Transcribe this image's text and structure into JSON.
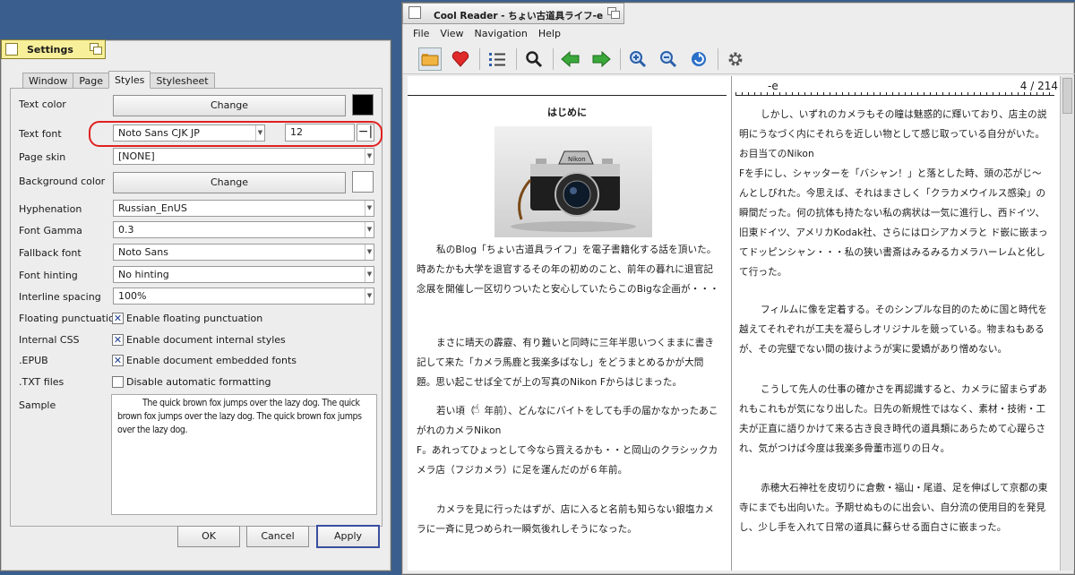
{
  "settings": {
    "title": "Settings",
    "tabs": [
      "Window",
      "Page",
      "Styles",
      "Stylesheet"
    ],
    "active_tab": "Styles",
    "text_color": {
      "label": "Text color",
      "button": "Change",
      "color": "#000000"
    },
    "text_font": {
      "label": "Text font",
      "value": "Noto Sans CJK JP",
      "size": "12"
    },
    "page_skin": {
      "label": "Page skin",
      "value": "[NONE]"
    },
    "background_color": {
      "label": "Background color",
      "button": "Change",
      "color": "#ffffff"
    },
    "hyphenation": {
      "label": "Hyphenation",
      "value": "Russian_EnUS"
    },
    "font_gamma": {
      "label": "Font Gamma",
      "value": "0.3"
    },
    "fallback_font": {
      "label": "Fallback font",
      "value": "Noto Sans"
    },
    "font_hinting": {
      "label": "Font hinting",
      "value": "No hinting"
    },
    "interline_spacing": {
      "label": "Interline spacing",
      "value": "100%"
    },
    "floating_punctuation": {
      "label": "Floating punctuation",
      "checkbox": "Enable floating punctuation",
      "checked": true
    },
    "internal_css": {
      "label": "Internal CSS",
      "checkbox": "Enable document internal styles",
      "checked": true
    },
    "epub": {
      "label": ".EPUB",
      "checkbox": "Enable document embedded fonts",
      "checked": true
    },
    "txt_files": {
      "label": ".TXT files",
      "checkbox": "Disable automatic formatting",
      "checked": false
    },
    "sample": {
      "label": "Sample",
      "text": "The quick brown fox jumps over the lazy dog. The quick brown fox jumps over the lazy dog. The quick brown fox jumps over the lazy dog."
    },
    "buttons": {
      "ok": "OK",
      "cancel": "Cancel",
      "apply": "Apply"
    }
  },
  "reader": {
    "title": "Cool Reader - ちょい古道具ライフ-e",
    "menu": [
      "File",
      "View",
      "Navigation",
      "Help"
    ],
    "toolbar_icons": [
      "open-folder-icon",
      "bookmark-heart-icon",
      "toc-list-icon",
      "search-icon",
      "back-arrow-icon",
      "forward-arrow-icon",
      "zoom-in-icon",
      "zoom-out-icon",
      "rotate-icon",
      "settings-gear-icon"
    ],
    "header_left": "-e",
    "page_indicator": "4 / 214",
    "left_page": {
      "heading": "はじめに",
      "paragraphs": [
        "私のBlog「ちょい古道具ライフ」を電子書籍化する話を頂いた。時あたかも大学を退官するその年の初めのこと、前年の暮れに退官記念展を開催し一区切りついたと安心していたらこのBigな企画が・・・",
        "まさに晴天の霹靂、有り難いと同時に三年半思いつくままに書き記して来た「カメラ馬鹿と我楽多ばなし」をどうまとめるかが大問題。思い起こせば全てが上の写真のNikon Fからはじまった。",
        "若い頃（　年前）、どんなにバイトをしても手の届かなかったあこがれのカメラNikon",
        "F。あれってひょっとして今なら買えるかも・・と岡山のクラシックカメラ店（フジカメラ）に足を運んだのが６年前。",
        "カメラを見に行ったはずが、店に入ると名前も知らない銀塩カメラに一斉に見つめられ一瞬気後れしそうになった。"
      ]
    },
    "right_page": {
      "paragraphs": [
        "しかし、いずれのカメラもその瞳は魅惑的に輝いており、店主の説明にうなづく内にそれらを近しい物として感じ取っている自分がいた。お目当てのNikon",
        "Fを手にし、シャッターを「バシャン！」と落とした時、頭の芯がじ〜んとしびれた。今思えば、それはまさしく「クラカメウイルス感染」の瞬間だった。何の抗体も持たない私の病状は一気に進行し、西ドイツ、旧東ドイツ、アメリカKodak社、さらにはロシアカメラと ド嵌に嵌まってドッピンシャン・・・私の狭い書斎はみるみるカメラハーレムと化して行った。",
        "フィルムに像を定着する。そのシンプルな目的のために国と時代を越えてそれぞれが工夫を凝らしオリジナルを競っている。物まねもあるが、その完璧でない間の抜けようが実に愛嬌があり憎めない。",
        "こうして先人の仕事の確かさを再認識すると、カメラに留まらずあれもこれもが気になり出した。日先の新規性ではなく、素材・技術・工夫が正直に語りかけて来る古き良き時代の道具類にあらためて心躍らされ、気がつけば今度は我楽多骨董市巡りの日々。",
        "赤穂大石神社を皮切りに倉敷・福山・尾道、足を伸ばして京都の東寺にまでも出向いた。予期せぬものに出会い、自分流の使用目的を発見し、少し手を入れて日常の道具に蘇らせる面白さに嵌まった。"
      ]
    }
  }
}
